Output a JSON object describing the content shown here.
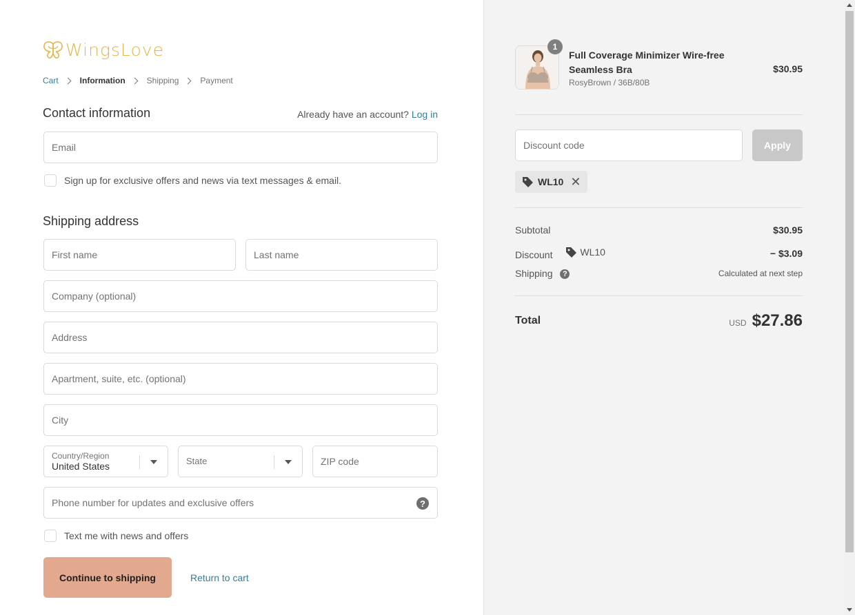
{
  "brand": {
    "name": "WingsLove",
    "logo_color": "#e3b64b"
  },
  "breadcrumb": {
    "cart": "Cart",
    "information": "Information",
    "shipping": "Shipping",
    "payment": "Payment"
  },
  "contact": {
    "title": "Contact information",
    "account_prompt": "Already have an account?",
    "login_label": "Log in",
    "email_placeholder": "Email",
    "newsletter_label": "Sign up for exclusive offers and news via text messages & email."
  },
  "shipping": {
    "title": "Shipping address",
    "first_name_placeholder": "First name",
    "last_name_placeholder": "Last name",
    "company_placeholder": "Company (optional)",
    "address_placeholder": "Address",
    "apartment_placeholder": "Apartment, suite, etc. (optional)",
    "city_placeholder": "City",
    "country_label": "Country/Region",
    "country_value": "United States",
    "state_label": "State",
    "zip_placeholder": "ZIP code",
    "phone_placeholder": "Phone number for updates and exclusive offers",
    "text_me_label": "Text me with news and offers"
  },
  "actions": {
    "continue_label": "Continue to shipping",
    "return_label": "Return to cart",
    "continue_color": "#e3a98e"
  },
  "order": {
    "product": {
      "quantity": "1",
      "name": "Full Coverage Minimizer Wire-free Seamless Bra",
      "variant": "RosyBrown / 36B/80B",
      "price": "$30.95"
    },
    "discount_placeholder": "Discount code",
    "apply_label": "Apply",
    "applied_code": "WL10",
    "subtotal_label": "Subtotal",
    "subtotal_value": "$30.95",
    "discount_label": "Discount",
    "discount_code": "WL10",
    "discount_value": "− $3.09",
    "shipping_label": "Shipping",
    "shipping_value": "Calculated at next step",
    "total_label": "Total",
    "currency": "USD",
    "total_value": "$27.86"
  }
}
